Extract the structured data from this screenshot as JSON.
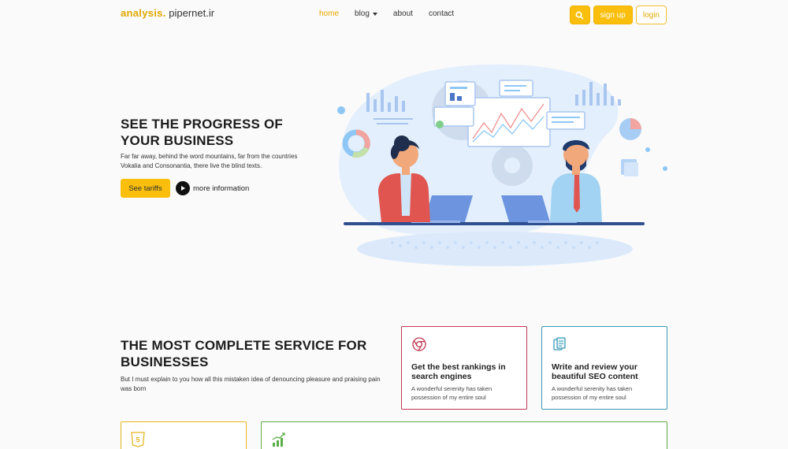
{
  "nav": {
    "brand_part1": "analysis.",
    "brand_part2": "pipernet.ir",
    "links": [
      {
        "label": "home",
        "active": true
      },
      {
        "label": "blog",
        "dropdown": true
      },
      {
        "label": "about"
      },
      {
        "label": "contact"
      }
    ],
    "signup_label": "sign up",
    "login_label": "login"
  },
  "hero": {
    "title_line1": "SEE THE PROGRESS OF",
    "title_line2": "YOUR BUSINESS",
    "description": "Far far away, behind the word mountains, far from the countries Vokalia and Consonantia, there live the blind texts.",
    "cta_label": "See tariffs",
    "more_label": "more information"
  },
  "services": {
    "title_line1": "THE MOST COMPLETE SERVICE FOR",
    "title_line2": "BUSINESSES",
    "description": "But I must explain to you how all this mistaken idea of denouncing pleasure and praising pain was born",
    "cards": [
      {
        "icon": "chrome-icon",
        "title": "Get the best rankings in search engines",
        "desc": "A wonderful serenity has taken possession of my entire soul",
        "color": "#c1364f"
      },
      {
        "icon": "documents-icon",
        "title": "Write and review your beautiful SEO content",
        "desc": "A wonderful serenity has taken possession of my entire soul",
        "color": "#3a99b6"
      },
      {
        "icon": "html5-icon",
        "color": "#e7b522"
      },
      {
        "icon": "growth-chart-icon",
        "color": "#5aae45"
      }
    ]
  },
  "colors": {
    "accent": "#f9bf0c",
    "text": "#1c1c1c"
  }
}
